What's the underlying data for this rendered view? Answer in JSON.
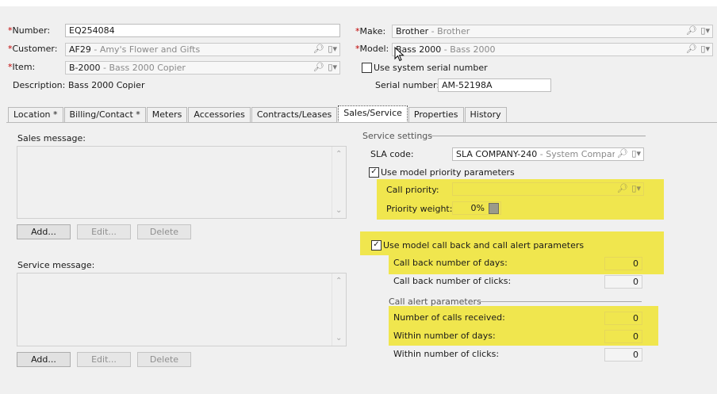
{
  "header": {
    "number_label": "Number:",
    "number_value": "EQ254084",
    "customer_label": "Customer:",
    "customer_code": "AF29",
    "customer_desc": " - Amy's Flower and Gifts",
    "item_label": "Item:",
    "item_code": "B-2000",
    "item_desc": " - Bass 2000 Copier",
    "description_label": "Description:",
    "description_value": "Bass 2000 Copier",
    "make_label": "Make:",
    "make_code": "Brother",
    "make_desc": " - Brother",
    "model_label": "Model:",
    "model_code": "Bass 2000",
    "model_desc": " - Bass 2000",
    "use_system_serial_label": "Use system serial number",
    "use_system_serial_checked": false,
    "serial_label": "Serial number:",
    "serial_value": "AM-52198A",
    "required_marker": "*"
  },
  "tabs": [
    {
      "label": "Location *",
      "active": false
    },
    {
      "label": "Billing/Contact *",
      "active": false
    },
    {
      "label": "Meters",
      "active": false
    },
    {
      "label": "Accessories",
      "active": false
    },
    {
      "label": "Contracts/Leases",
      "active": false
    },
    {
      "label": "Sales/Service",
      "active": true
    },
    {
      "label": "Properties",
      "active": false
    },
    {
      "label": "History",
      "active": false
    }
  ],
  "sales_message": {
    "label": "Sales message:",
    "add_label": "Add...",
    "edit_label": "Edit...",
    "delete_label": "Delete"
  },
  "service_message": {
    "label": "Service message:",
    "add_label": "Add...",
    "edit_label": "Edit...",
    "delete_label": "Delete"
  },
  "service_settings": {
    "group_label": "Service settings",
    "sla_label": "SLA code:",
    "sla_code": "SLA COMPANY-240",
    "sla_desc": " - System Company Hc",
    "use_model_priority_label": "Use model priority parameters",
    "use_model_priority_checked": true,
    "call_priority_label": "Call priority:",
    "priority_weight_label": "Priority weight:",
    "priority_weight_value": "0%",
    "use_model_callback_label": "Use model call back and call alert parameters",
    "use_model_callback_checked": true,
    "callback_days_label": "Call back number of days:",
    "callback_days_value": "0",
    "callback_clicks_label": "Call back number of clicks:",
    "callback_clicks_value": "0",
    "call_alert_group_label": "Call alert parameters",
    "calls_received_label": "Number of calls received:",
    "calls_received_value": "0",
    "within_days_label": "Within number of days:",
    "within_days_value": "0",
    "within_clicks_label": "Within number of clicks:",
    "within_clicks_value": "0",
    "highlight_color": "#f0e64e"
  },
  "icons": {
    "lookup": "magnifier-icon",
    "menu": "dropdown-menu-icon",
    "calculator": "calculator-icon"
  }
}
